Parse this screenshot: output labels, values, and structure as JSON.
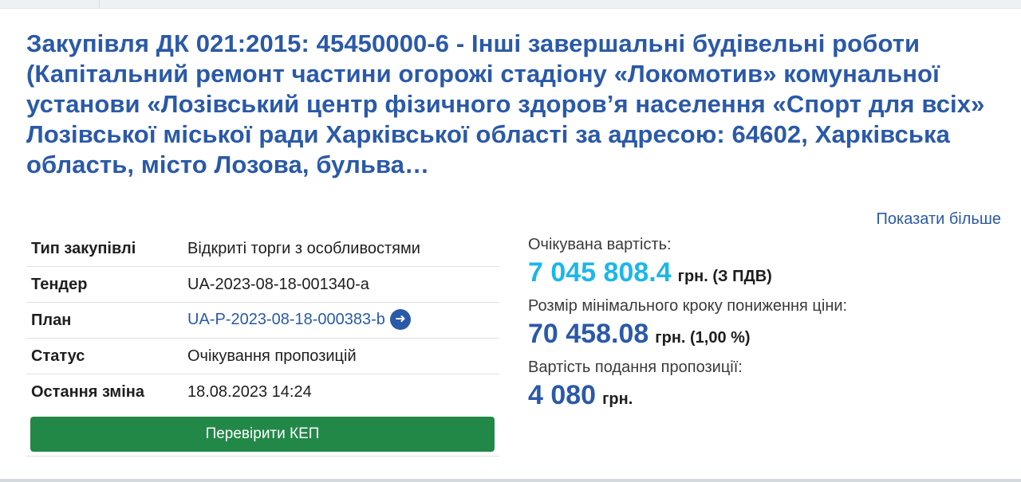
{
  "title": "Закупівля ДК 021:2015: 45450000-6 - Інші завершальні будівельні роботи (Капітальний ремонт частини огорожі стадіону «Локомотив» комунальної установи «Лозівський центр фізичного здоров’я населення «Спорт для всіх» Лозівської міської ради Харківської області за адресою: 64602, Харківська область, місто Лозова, бульва…",
  "show_more": "Показати більше",
  "info": {
    "procurement_type": {
      "label": "Тип закупівлі",
      "value": "Відкриті торги з особливостями"
    },
    "tender": {
      "label": "Тендер",
      "value": "UA-2023-08-18-001340-a"
    },
    "plan": {
      "label": "План",
      "value": "UA-P-2023-08-18-000383-b"
    },
    "status": {
      "label": "Статус",
      "value": "Очікування пропозицій"
    },
    "last_change": {
      "label": "Остання зміна",
      "value": "18.08.2023 14:24"
    }
  },
  "verify_button": "Перевірити КЕП",
  "expected_cost": {
    "label": "Очікувана вартість:",
    "amount": "7 045 808.4",
    "unit": "грн. (З ПДВ)"
  },
  "min_step": {
    "label": "Розмір мінімального кроку пониження ціни:",
    "amount": "70 458.08",
    "unit": "грн. (1,00 %)"
  },
  "submission_cost": {
    "label": "Вартість подання пропозиції:",
    "amount": "4 080",
    "unit": "грн."
  },
  "icons": {
    "plan_link": "arrow-left-circle-icon"
  },
  "colors": {
    "link": "#2a59a8",
    "accent_cyan": "#1cb7e8",
    "button": "#228848"
  }
}
